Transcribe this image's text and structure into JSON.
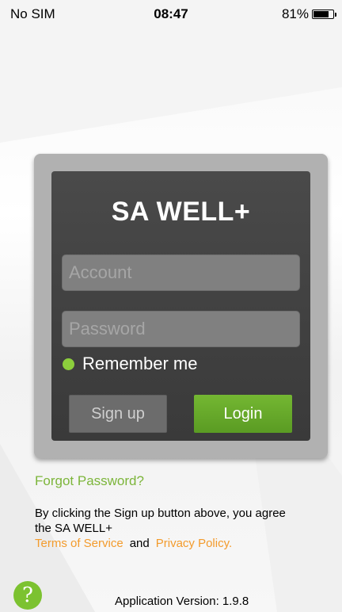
{
  "status_bar": {
    "carrier": "No SIM",
    "time": "08:47",
    "battery_percent": "81%",
    "battery_level": 0.81
  },
  "login_card": {
    "app_title": "SA WELL+",
    "account_placeholder": "Account",
    "password_placeholder": "Password",
    "remember_label": "Remember me",
    "remember_checked": true,
    "signup_label": "Sign up",
    "login_label": "Login"
  },
  "footer": {
    "forgot_password": "Forgot Password?",
    "terms_text": "By clicking the Sign up button above, you agree the SA WELL+",
    "terms_of_service": "Terms of Service",
    "and": "and",
    "privacy_policy": "Privacy Policy.",
    "help_icon_glyph": "?",
    "version": "Application Version: 1.9.8"
  },
  "colors": {
    "accent_green": "#7cb53a",
    "link_orange": "#f39b2c",
    "card_dark": "#434343"
  },
  "icons": {
    "battery": "battery-icon",
    "remember": "remember-dot-icon",
    "help": "help-icon"
  }
}
